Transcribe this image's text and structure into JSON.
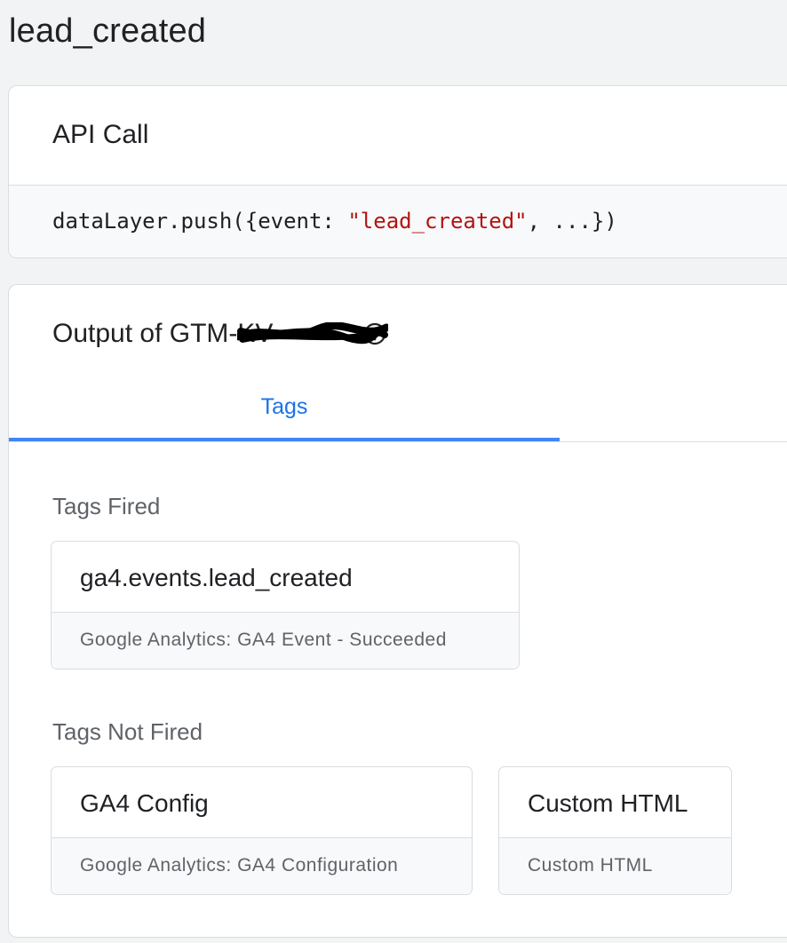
{
  "page": {
    "title": "lead_created"
  },
  "api_call": {
    "heading": "API Call",
    "code_prefix": "dataLayer.push({event: ",
    "code_event": "\"lead_created\"",
    "code_suffix": ", ...})"
  },
  "output": {
    "title_prefix": "Output of GTM-",
    "container_id_visible": "KV",
    "help_icon": "help-circle-icon",
    "tabs": [
      {
        "label": "Tags",
        "active": true
      }
    ],
    "tags_fired": {
      "label": "Tags Fired",
      "items": [
        {
          "name": "ga4.events.lead_created",
          "type": "Google Analytics: GA4 Event - Succeeded"
        }
      ]
    },
    "tags_not_fired": {
      "label": "Tags Not Fired",
      "items": [
        {
          "name": "GA4 Config",
          "type": "Google Analytics: GA4 Configuration"
        },
        {
          "name": "Custom HTML",
          "type": "Custom HTML"
        }
      ]
    }
  },
  "colors": {
    "accent": "#1a73e8",
    "tab_indicator": "#4285f4",
    "code_string": "#b31412",
    "background": "#f1f3f4",
    "border": "#dadce0"
  }
}
